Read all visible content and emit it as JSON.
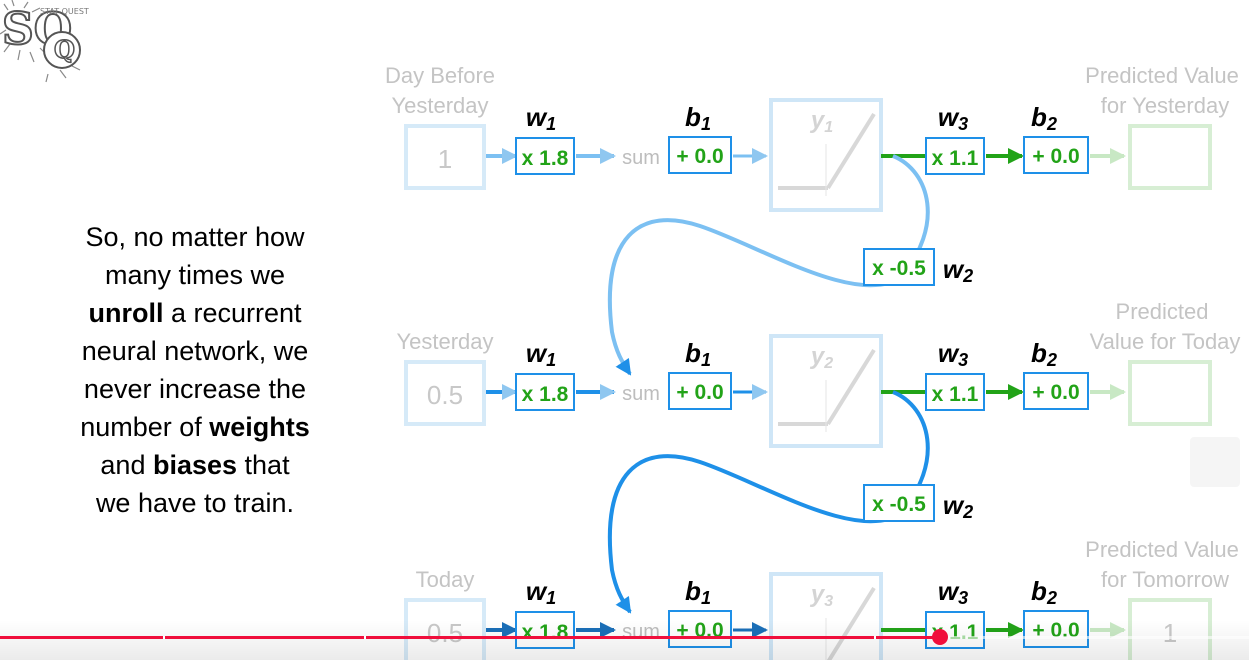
{
  "logo": {
    "letters": "SQ",
    "tagline": "STAT QUEST"
  },
  "caption": {
    "line1": "So, no matter how",
    "line2": "many times we",
    "line3_bold": "unroll",
    "line3_rest": " a recurrent",
    "line4": "neural network, we",
    "line5": "never increase the",
    "line6_pre": "number of ",
    "line6_bold": "weights",
    "line7_pre": "and ",
    "line7_bold": "biases",
    "line7_post": " that",
    "line8": "we have to train."
  },
  "rows": [
    {
      "input_label_1": "Day Before",
      "input_label_2": "Yesterday",
      "input_value": "1",
      "w1": "x 1.8",
      "b1": "+ 0.0",
      "y_label": "y",
      "y_sub": "1",
      "w3": "x 1.1",
      "b2": "+ 0.0",
      "output_label_1": "Predicted Value",
      "output_label_2": "for Yesterday",
      "output_value": ""
    },
    {
      "input_label_1": "Yesterday",
      "input_value": "0.5",
      "w1": "x 1.8",
      "b1": "+ 0.0",
      "y_label": "y",
      "y_sub": "2",
      "w3": "x 1.1",
      "b2": "+ 0.0",
      "output_label_1": "Predicted",
      "output_label_2": "Value for Today",
      "output_value": ""
    },
    {
      "input_label_1": "Today",
      "input_value": "0.5",
      "w1": "x 1.8",
      "b1": "+ 0.0",
      "y_label": "y",
      "y_sub": "3",
      "w3": "x 1.1",
      "b2": "+ 0.0",
      "output_label_1": "Predicted Value",
      "output_label_2": "for Tomorrow",
      "output_value": "1"
    }
  ],
  "feedback": [
    {
      "value": "x -0.5",
      "name": "w",
      "sub": "2"
    },
    {
      "value": "x -0.5",
      "name": "w",
      "sub": "2"
    }
  ],
  "weight_names": {
    "w1": "w",
    "w1_sub": "1",
    "b1": "b",
    "b1_sub": "1",
    "w3": "w",
    "w3_sub": "3",
    "b2": "b",
    "b2_sub": "2"
  },
  "sum_label": "sum",
  "video": {
    "progress": 0.753
  },
  "colors": {
    "blue": "#1e90e8",
    "light_blue": "#b8dcf5",
    "green": "#22a318",
    "light_green": "#c8e8c4",
    "progress": "#f00f3c"
  }
}
